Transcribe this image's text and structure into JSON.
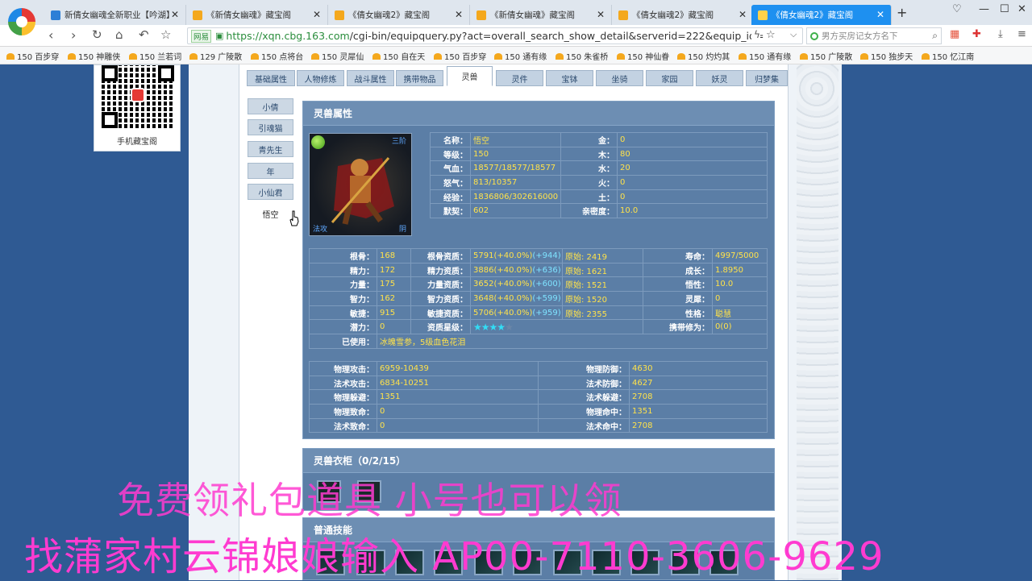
{
  "browser": {
    "tabs": [
      {
        "label": "新倩女幽魂全新职业【吟湖】",
        "active": false
      },
      {
        "label": "《新倩女幽魂》藏宝阁",
        "active": false
      },
      {
        "label": "《倩女幽魂2》藏宝阁",
        "active": false
      },
      {
        "label": "《新倩女幽魂》藏宝阁",
        "active": false
      },
      {
        "label": "《倩女幽魂2》藏宝阁",
        "active": false
      },
      {
        "label": "《倩女幽魂2》藏宝阁",
        "active": true
      }
    ],
    "url_badge": "网易",
    "url_host": "https://xqn.cbg.163.com",
    "url_path": "/cgi-bin/equipquery.py?act=overall_search_show_detail&serverid=222&equip_id=",
    "search_placeholder": "男方买房记女方名下",
    "bookmarks": [
      "150 百步穿",
      "150 神雕侠",
      "150 兰若词",
      "129 广陵散",
      "150 点将台",
      "150 灵犀仙",
      "150 自在天",
      "150 百步穿",
      "150 通有缘",
      "150 朱雀桥",
      "150 神仙眷",
      "150 灼灼其",
      "150 通有缘",
      "150 广陵散",
      "150 独步天",
      "150 忆江南"
    ]
  },
  "qr": {
    "caption": "手机藏宝阁"
  },
  "top_tabs": [
    "基础属性",
    "人物修炼",
    "战斗属性",
    "携带物品",
    "灵兽",
    "灵件",
    "宝钵",
    "坐骑",
    "家园",
    "妖灵",
    "归梦集"
  ],
  "active_top_tab": "灵兽",
  "left_tabs": [
    "小倩",
    "引魂猫",
    "青先生",
    "年",
    "小仙君",
    "悟空"
  ],
  "active_left_tab": "悟空",
  "pet_section": {
    "title": "灵兽属性",
    "image_labels": {
      "top_right": "三阶",
      "bottom_left": "法攻",
      "bottom_right": "阴"
    },
    "basic": [
      {
        "k": "名称：",
        "v": "悟空",
        "k2": "金：",
        "v2": "0"
      },
      {
        "k": "等级：",
        "v": "150",
        "k2": "木：",
        "v2": "80"
      },
      {
        "k": "气血：",
        "v": "18577/18577/18577",
        "k2": "水：",
        "v2": "20"
      },
      {
        "k": "怒气：",
        "v": "813/10357",
        "k2": "火：",
        "v2": "0"
      },
      {
        "k": "经验：",
        "v": "1836806/302616000",
        "k2": "土：",
        "v2": "0"
      },
      {
        "k": "默契：",
        "v": "602",
        "k2": "亲密度：",
        "v2": "10.0"
      }
    ],
    "attrs": [
      {
        "k": "根骨：",
        "v": "168",
        "k2": "根骨资质：",
        "v2": "5791(+40.0%)",
        "p2": "(+944)",
        "o": "原始: 2419",
        "k3": "寿命：",
        "v3": "4997/5000"
      },
      {
        "k": "精力：",
        "v": "172",
        "k2": "精力资质：",
        "v2": "3886(+40.0%)",
        "p2": "(+636)",
        "o": "原始: 1621",
        "k3": "成长：",
        "v3": "1.8950"
      },
      {
        "k": "力量：",
        "v": "175",
        "k2": "力量资质：",
        "v2": "3652(+40.0%)",
        "p2": "(+600)",
        "o": "原始: 1521",
        "k3": "悟性：",
        "v3": "10.0"
      },
      {
        "k": "智力：",
        "v": "162",
        "k2": "智力资质：",
        "v2": "3648(+40.0%)",
        "p2": "(+599)",
        "o": "原始: 1520",
        "k3": "灵犀：",
        "v3": "0"
      },
      {
        "k": "敏捷：",
        "v": "915",
        "k2": "敏捷资质：",
        "v2": "5706(+40.0%)",
        "p2": "(+959)",
        "o": "原始: 2355",
        "k3": "性格：",
        "v3": "聪慧"
      }
    ],
    "potential": {
      "k": "潜力：",
      "v": "0",
      "k2": "资质星级：",
      "stars": 4,
      "star_total": 5,
      "k3": "携带修为：",
      "v3": "0(0)"
    },
    "used": {
      "k": "已使用：",
      "v": "冰魄雪参，5级血色花泪"
    },
    "combat": [
      {
        "k": "物理攻击：",
        "v": "6959-10439",
        "k2": "物理防御：",
        "v2": "4630"
      },
      {
        "k": "法术攻击：",
        "v": "6834-10251",
        "k2": "法术防御：",
        "v2": "4627"
      },
      {
        "k": "物理躲避：",
        "v": "1351",
        "k2": "法术躲避：",
        "v2": "2708"
      },
      {
        "k": "物理致命：",
        "v": "0",
        "k2": "物理命中：",
        "v2": "1351"
      },
      {
        "k": "法术致命：",
        "v": "0",
        "k2": "法术命中：",
        "v2": "2708"
      }
    ]
  },
  "wardrobe": {
    "title": "灵兽衣柜（0/2/15）"
  },
  "skills": {
    "title": "普通技能"
  },
  "overlay": {
    "line1": "免费领礼包道具 小号也可以领",
    "line2": "找蒲家村云锦娘娘输入 AP00-7110-3606-9629"
  },
  "colors": {
    "accent": "#1e90f0",
    "panel": "#5b7ea6",
    "value": "#ffe24a",
    "overlay": "#ff3bd0"
  }
}
